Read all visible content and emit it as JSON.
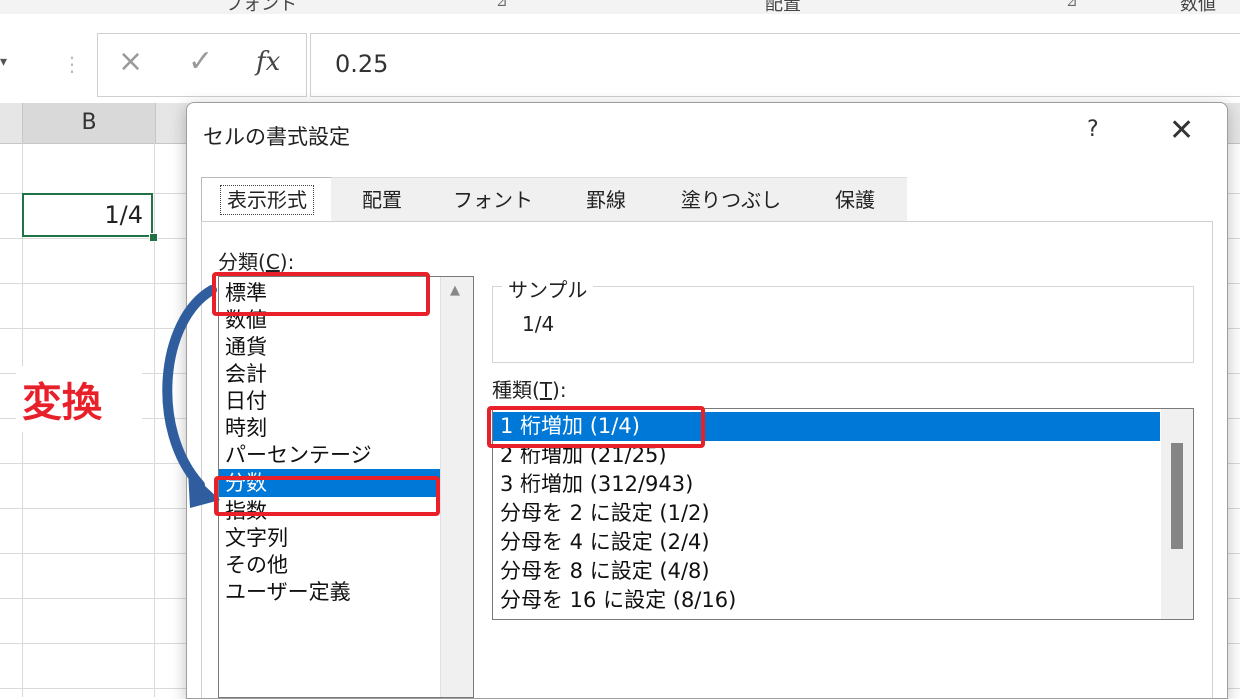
{
  "ribbon": {
    "groups": [
      "フォント",
      "配置",
      "数値"
    ]
  },
  "formula_bar": {
    "cancel_icon": "×",
    "enter_icon": "✓",
    "fx_label": "fx",
    "value": "0.25"
  },
  "sheet": {
    "column_header": "B",
    "active_cell_value": "1/4"
  },
  "annotation": {
    "label": "変換",
    "color": "#e8202a"
  },
  "dialog": {
    "title": "セルの書式設定",
    "help": "?",
    "close": "✕",
    "tabs": [
      "表示形式",
      "配置",
      "フォント",
      "罫線",
      "塗りつぶし",
      "保護"
    ],
    "active_tab": "表示形式",
    "category_label": "分類(",
    "category_key": "C",
    "category_suffix": "):",
    "categories": [
      "標準",
      "数値",
      "通貨",
      "会計",
      "日付",
      "時刻",
      "パーセンテージ",
      "分数",
      "指数",
      "文字列",
      "その他",
      "ユーザー定義"
    ],
    "selected_category": "分数",
    "sample_legend": "サンプル",
    "sample_value": "1/4",
    "type_label": "種類(",
    "type_key": "T",
    "type_suffix": "):",
    "types": [
      "1 桁増加 (1/4)",
      "2 桁増加 (21/25)",
      "3 桁増加 (312/943)",
      "分母を 2 に設定 (1/2)",
      "分母を 4 に設定 (2/4)",
      "分母を 8 に設定 (4/8)",
      "分母を 16 に設定 (8/16)"
    ],
    "selected_type": "1 桁増加 (1/4)",
    "selection_color": "#0078d7"
  }
}
